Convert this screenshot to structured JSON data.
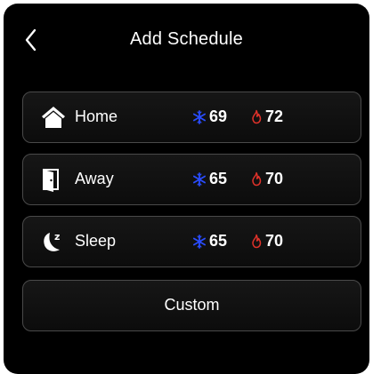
{
  "header": {
    "title": "Add Schedule",
    "back_icon": "chevron-left-icon"
  },
  "schedules": [
    {
      "label": "Home",
      "icon": "home-icon",
      "cool": "69",
      "heat": "72"
    },
    {
      "label": "Away",
      "icon": "door-icon",
      "cool": "65",
      "heat": "70"
    },
    {
      "label": "Sleep",
      "icon": "moon-icon",
      "cool": "65",
      "heat": "70"
    }
  ],
  "custom": {
    "label": "Custom"
  },
  "colors": {
    "cool": "#2a4dff",
    "heat": "#e0322a",
    "background": "#000000",
    "row_border": "#4a4a4a"
  }
}
